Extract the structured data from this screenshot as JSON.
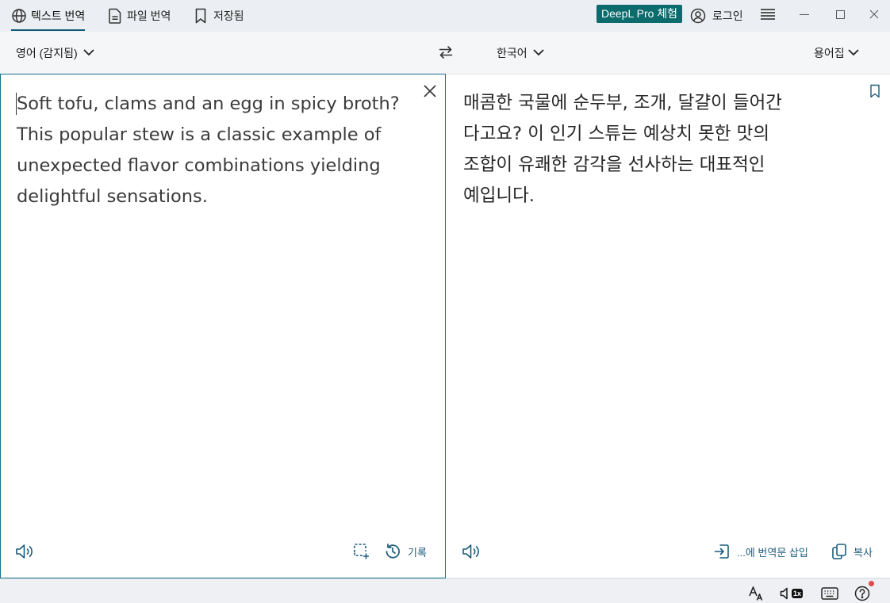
{
  "tabs": [
    {
      "label": "텍스트 번역",
      "icon": "globe-icon",
      "active": true
    },
    {
      "label": "파일 번역",
      "icon": "file-icon",
      "active": false
    },
    {
      "label": "저장됨",
      "icon": "bookmark-icon",
      "active": false
    }
  ],
  "header": {
    "pro_badge": "DeepL Pro 체험",
    "login_label": "로그인",
    "login_icon": "user-circle-icon",
    "menu_icon": "hamburger-menu-icon",
    "window_controls": [
      "minimize-icon",
      "maximize-icon",
      "close-icon"
    ]
  },
  "languages": {
    "source": "영어 (감지됨)",
    "swap_icon": "swap-arrows-icon",
    "target": "한국어",
    "glossary": "용어집"
  },
  "source": {
    "text": "Soft tofu, clams and an egg in spicy broth? This popular stew is a classic example of unexpected flavor combinations yielding delightful sensations.",
    "actions": {
      "clear_icon": "close-icon",
      "listen_icon": "speaker-icon",
      "select_icon": "select-area-icon",
      "history_icon": "history-icon",
      "history_label": "기록"
    }
  },
  "target": {
    "lines": [
      "매콤한 국물에 순두부, 조개, 달걀이 들어간",
      "다고요? 이 인기 스튜는 예상치 못한 맛의",
      "조합이 유쾌한 감각을 선사하는 대표적인",
      "예입니다."
    ],
    "bookmark_icon": "bookmark-icon",
    "actions": {
      "listen_icon": "speaker-icon",
      "insert_icon": "insert-icon",
      "insert_label": "...에 번역문 삽입",
      "copy_icon": "copy-icon",
      "copy_label": "복사"
    }
  },
  "status_bar": {
    "text_size_icon": "text-size-icon",
    "speech_speed_icon": "speaker-icon",
    "speech_speed": "1x",
    "keyboard_icon": "keyboard-icon",
    "help_icon": "help-icon",
    "help_has_notification": true
  },
  "colors": {
    "pro-badge": "#0b6b6d",
    "active-border": "#14708a",
    "tab-underline": "#135a78",
    "action": "#1c5b7c",
    "notification-dot": "#e2494b"
  }
}
